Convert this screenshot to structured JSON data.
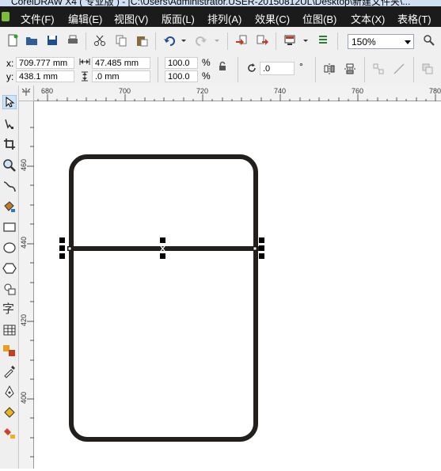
{
  "window": {
    "title": "CorelDRAW X4 ( 专业版 ) - [C:\\Users\\Administrator.USER-20150812UL\\Desktop\\新建文件夹\\..."
  },
  "menu": {
    "items": [
      "文件(F)",
      "编辑(E)",
      "视图(V)",
      "版面(L)",
      "排列(A)",
      "效果(C)",
      "位图(B)",
      "文本(X)",
      "表格(T)"
    ]
  },
  "toolbar": {
    "zoom_value": "150%"
  },
  "property_bar": {
    "x_label": "x:",
    "x_value": "709.777 mm",
    "y_label": "y:",
    "y_value": "438.1 mm",
    "width_value": "47.485 mm",
    "height_value": ".0 mm",
    "scale_w": "100.0",
    "scale_h": "100.0",
    "percent": "%",
    "rotation": ".0",
    "degree": "°"
  },
  "rulers": {
    "horizontal_ticks": [
      "680",
      "700",
      "720",
      "740",
      "760",
      "780"
    ],
    "vertical_ticks": [
      "460",
      "440",
      "420",
      "400"
    ]
  },
  "icons": [
    "new-icon",
    "open-icon",
    "save-icon",
    "print-icon",
    "cut-icon",
    "copy-icon",
    "paste-icon",
    "undo-icon",
    "redo-icon",
    "import-icon",
    "export-icon",
    "application-launcher-icon",
    "welcome-icon",
    "snap-icon",
    "lock-ratio-icon",
    "rotate-icon",
    "mirror-h-icon",
    "mirror-v-icon",
    "pick-tool-icon",
    "shape-tool-icon",
    "crop-tool-icon",
    "zoom-tool-icon",
    "freehand-tool-icon",
    "smart-fill-icon",
    "rectangle-tool-icon",
    "ellipse-tool-icon",
    "polygon-tool-icon",
    "basic-shapes-icon",
    "text-tool-icon",
    "table-tool-icon",
    "interactive-blend-icon",
    "eyedropper-icon",
    "outline-pen-icon",
    "fill-tool-icon",
    "interactive-fill-icon"
  ],
  "colors": {
    "menubar_bg": "#1b1b1b",
    "shape_stroke": "#231f1c",
    "ui_bg": "#f0f0f0"
  }
}
